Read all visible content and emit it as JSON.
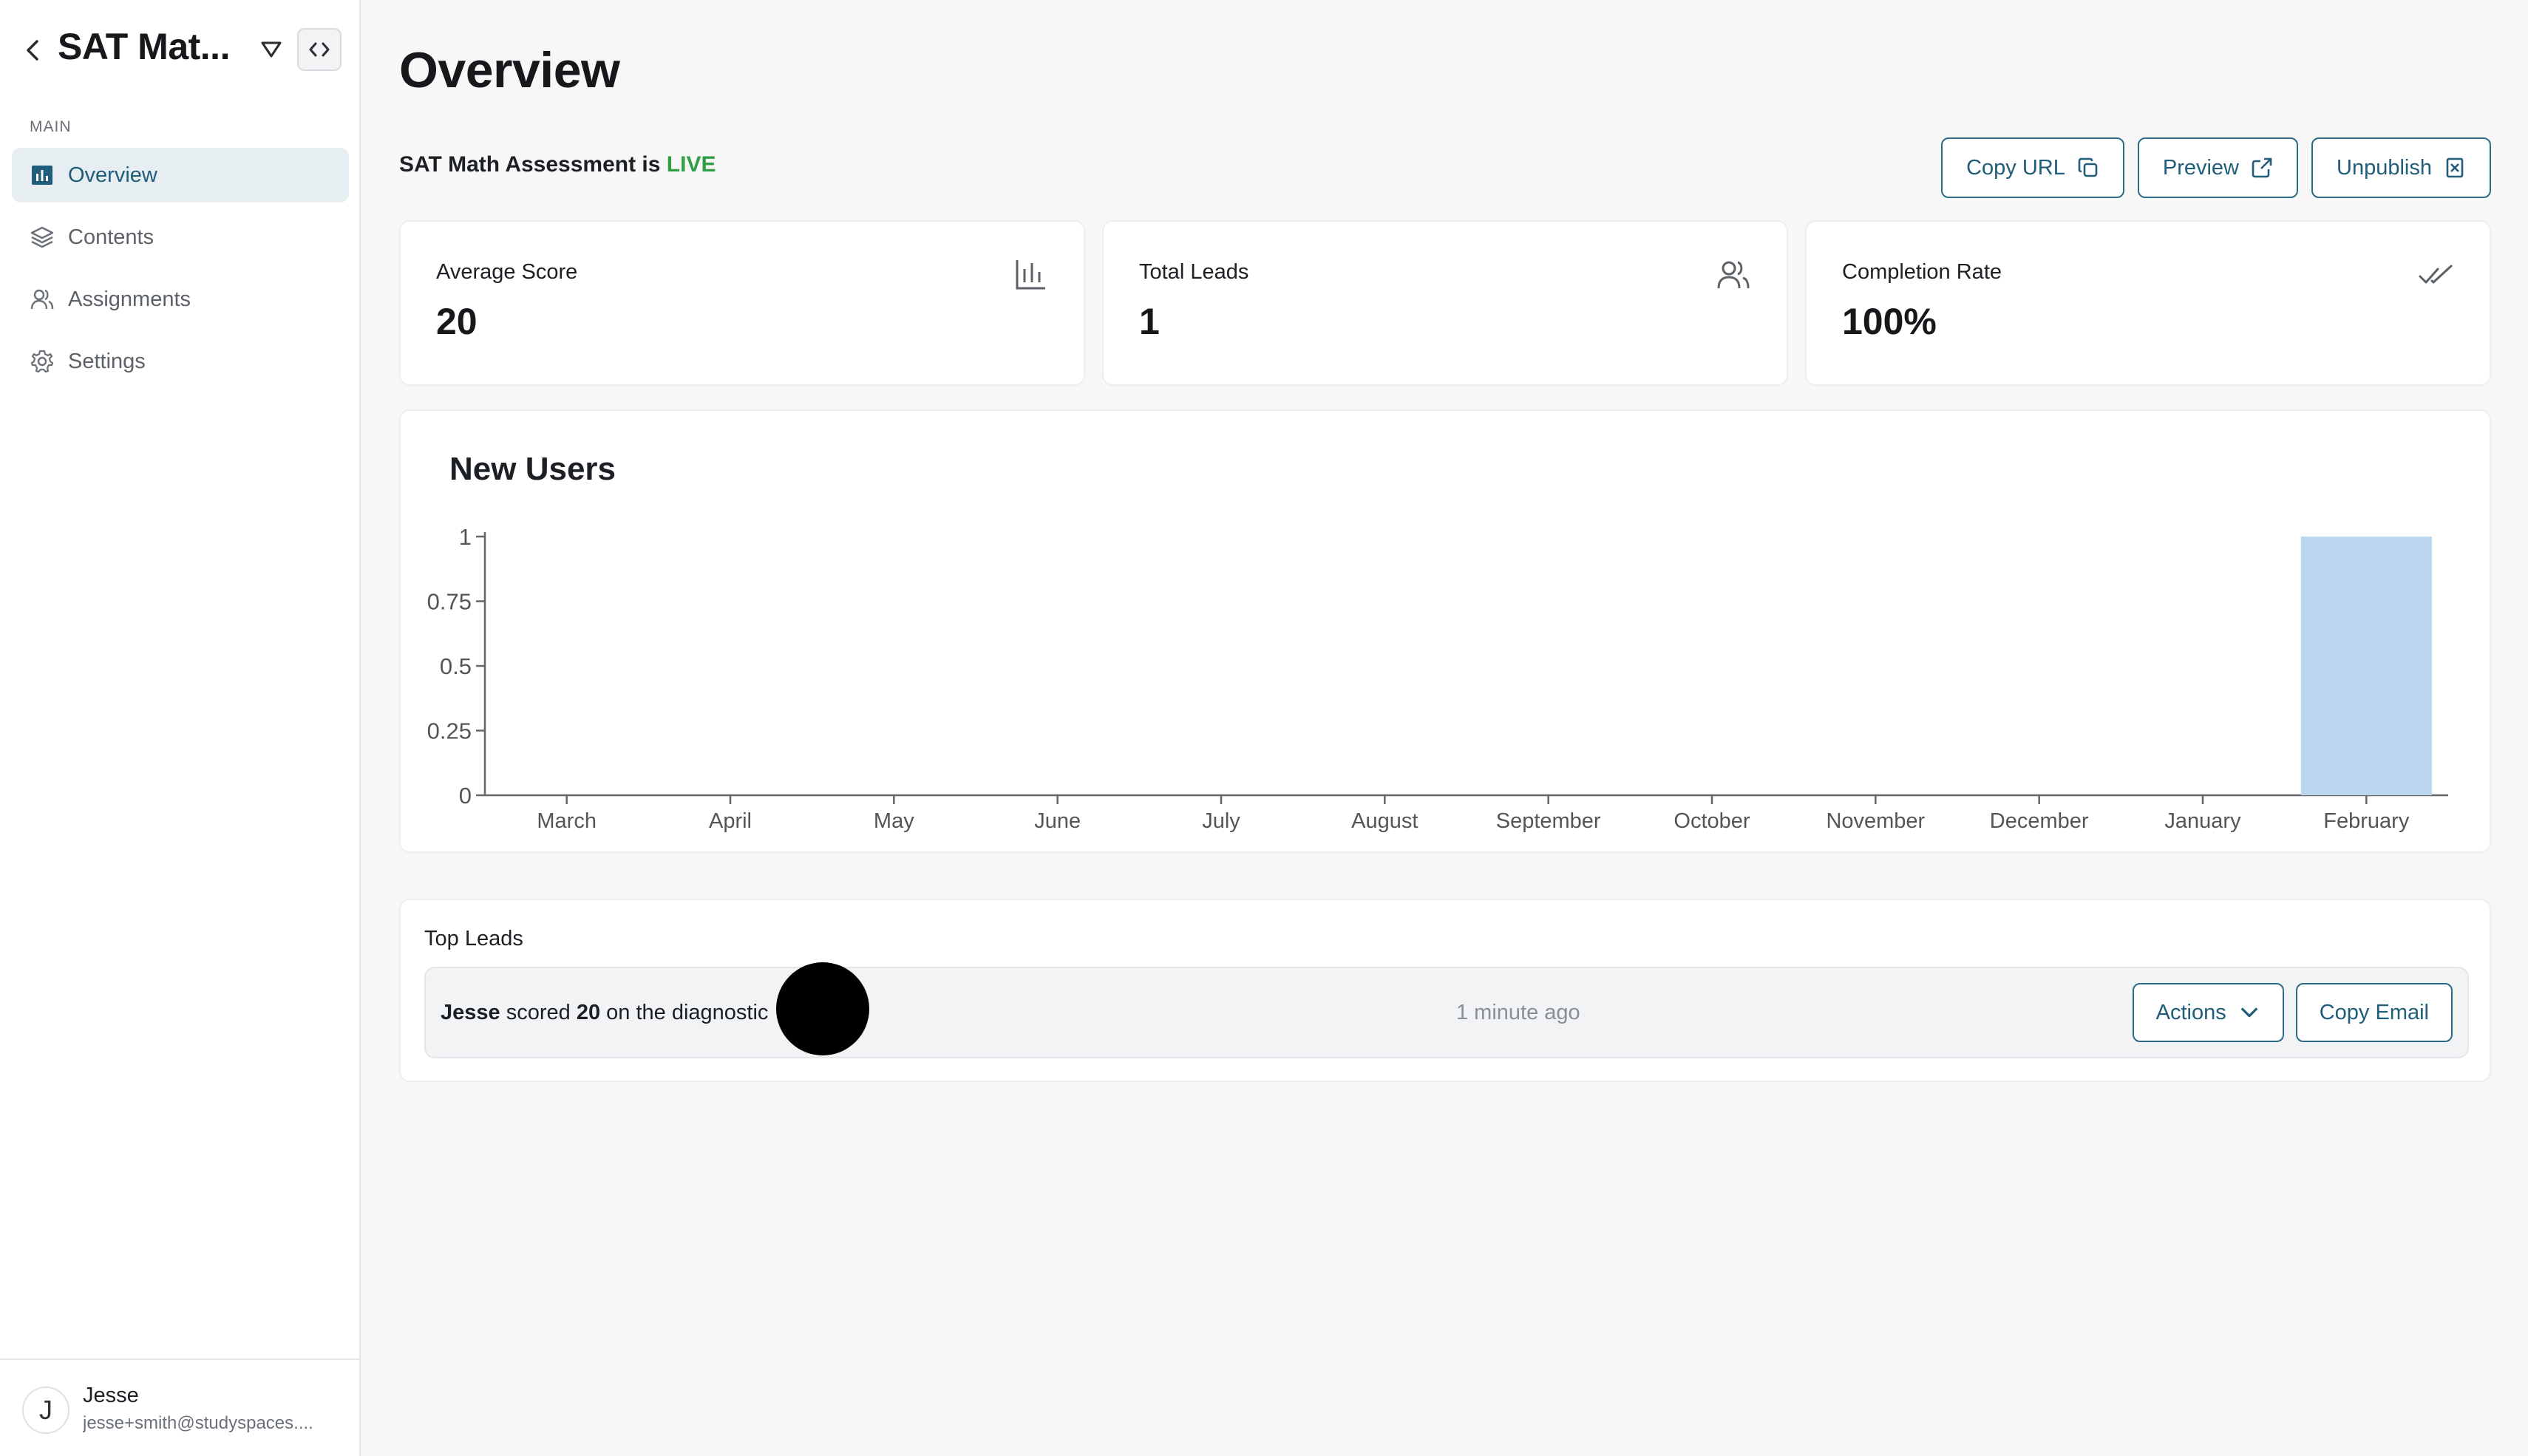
{
  "app": {
    "title": "SAT Mat..."
  },
  "sidebar": {
    "section_label": "MAIN",
    "items": [
      {
        "label": "Overview",
        "icon": "bar-chart-square-icon",
        "active": true
      },
      {
        "label": "Contents",
        "icon": "layers-icon",
        "active": false
      },
      {
        "label": "Assignments",
        "icon": "users-icon",
        "active": false
      },
      {
        "label": "Settings",
        "icon": "gear-icon",
        "active": false
      }
    ],
    "user": {
      "initial": "J",
      "name": "Jesse",
      "email": "jesse+smith@studyspaces...."
    }
  },
  "page": {
    "title": "Overview",
    "status_prefix": "SAT Math Assessment is",
    "status_value": "LIVE",
    "buttons": {
      "copy_url": "Copy URL",
      "preview": "Preview",
      "unpublish": "Unpublish"
    }
  },
  "stats": [
    {
      "label": "Average Score",
      "value": "20",
      "icon": "bar-chart-icon"
    },
    {
      "label": "Total Leads",
      "value": "1",
      "icon": "users-icon"
    },
    {
      "label": "Completion Rate",
      "value": "100%",
      "icon": "double-check-icon"
    }
  ],
  "chart_data": {
    "type": "bar",
    "title": "New Users",
    "categories": [
      "March",
      "April",
      "May",
      "June",
      "July",
      "August",
      "September",
      "October",
      "November",
      "December",
      "January",
      "February"
    ],
    "values": [
      0,
      0,
      0,
      0,
      0,
      0,
      0,
      0,
      0,
      0,
      0,
      1
    ],
    "yticks": [
      "1",
      "0.75",
      "0.5",
      "0.25",
      "0"
    ],
    "ylim": [
      0,
      1
    ],
    "xlabel": "",
    "ylabel": "",
    "grid": false,
    "bar_color": "#bcd6f0"
  },
  "leads": {
    "title": "Top Leads",
    "rows": [
      {
        "name": "Jesse",
        "text_mid": "scored",
        "score": "20",
        "text_end": "on the diagnostic",
        "time": "1 minute ago",
        "actions_label": "Actions",
        "copy_email_label": "Copy Email"
      }
    ]
  },
  "colors": {
    "accent": "#1f5d7a",
    "live": "#2f9e44",
    "active_nav_bg": "#e6eef2"
  }
}
